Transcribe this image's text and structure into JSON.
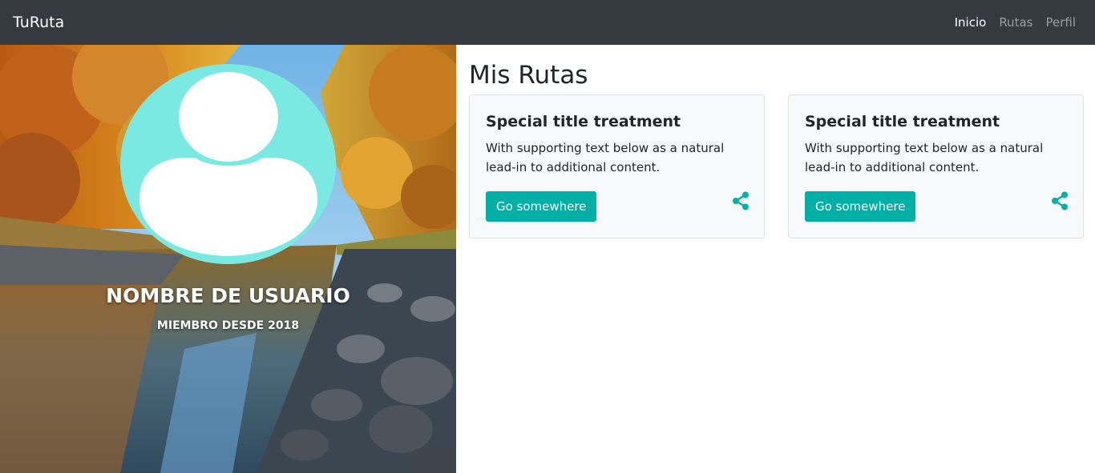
{
  "navbar": {
    "brand": "TuRuta",
    "items": [
      {
        "label": "Inicio",
        "active": true
      },
      {
        "label": "Rutas",
        "active": false
      },
      {
        "label": "Perfil",
        "active": false
      }
    ]
  },
  "profile": {
    "avatar_icon": "user-silhouette-icon",
    "name": "NOMBRE DE USUARIO",
    "member_since": "MIEMBRO DESDE 2018"
  },
  "main": {
    "heading": "Mis Rutas",
    "cards": [
      {
        "title": "Special title treatment",
        "text": "With supporting text below as a natural lead-in to additional content.",
        "button": "Go somewhere",
        "share_icon": "share-icon"
      },
      {
        "title": "Special title treatment",
        "text": "With supporting text below as a natural lead-in to additional content.",
        "button": "Go somewhere",
        "share_icon": "share-icon"
      }
    ]
  },
  "colors": {
    "navbar": "#343a40",
    "accent": "#00b0a6",
    "avatar_circle": "#7ae9e2",
    "card_bg": "#f8f9fa"
  }
}
